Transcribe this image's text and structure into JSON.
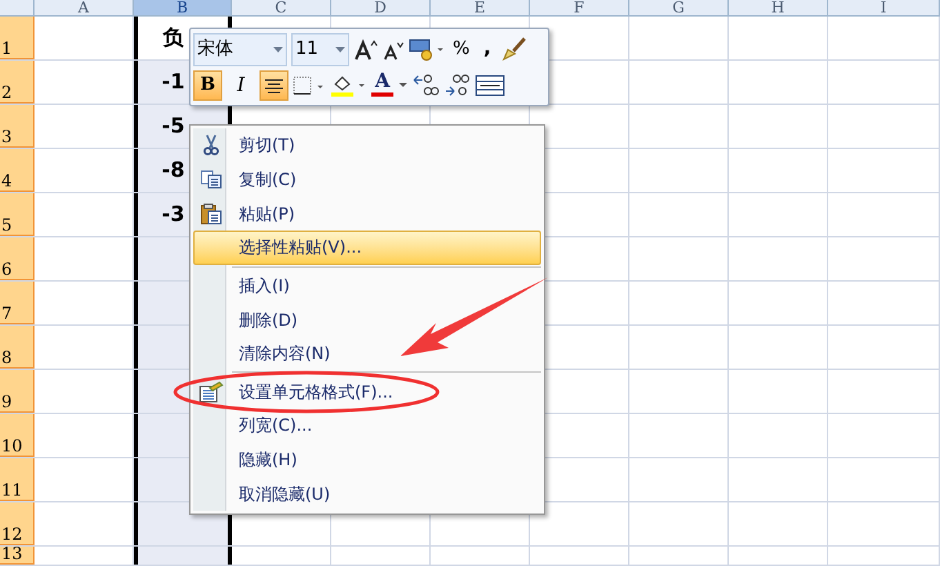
{
  "columns": [
    {
      "label": "A",
      "selected": false
    },
    {
      "label": "B",
      "selected": true
    },
    {
      "label": "C",
      "selected": false
    },
    {
      "label": "D",
      "selected": false
    },
    {
      "label": "E",
      "selected": false
    },
    {
      "label": "F",
      "selected": false
    },
    {
      "label": "G",
      "selected": false
    },
    {
      "label": "H",
      "selected": false
    },
    {
      "label": "I",
      "selected": false
    }
  ],
  "rows": [
    {
      "number": "1",
      "cell_b": "负",
      "selected": true
    },
    {
      "number": "2",
      "cell_b": "-1",
      "selected": true
    },
    {
      "number": "3",
      "cell_b": "-5",
      "selected": true
    },
    {
      "number": "4",
      "cell_b": "-8",
      "selected": true
    },
    {
      "number": "5",
      "cell_b": "-3",
      "selected": true
    },
    {
      "number": "6",
      "selected": true
    },
    {
      "number": "7",
      "selected": true
    },
    {
      "number": "8",
      "selected": true
    },
    {
      "number": "9",
      "selected": true
    },
    {
      "number": "10",
      "selected": true
    },
    {
      "number": "11",
      "selected": true
    },
    {
      "number": "12",
      "selected": true
    },
    {
      "number": "13",
      "selected": true
    }
  ],
  "toolbar": {
    "font": "宋体",
    "size": "11",
    "percent": "%",
    "comma": ",",
    "bold": {
      "label": "B",
      "selected": true
    },
    "italic": {
      "label": "I",
      "selected": false
    },
    "center": {
      "selected": true
    },
    "font_color_label": "A"
  },
  "menu": [
    {
      "kind": "item",
      "label": "剪切(T)",
      "highlighted": false
    },
    {
      "kind": "item",
      "label": "复制(C)",
      "highlighted": false
    },
    {
      "kind": "item",
      "label": "粘贴(P)",
      "highlighted": false
    },
    {
      "kind": "item",
      "label": "选择性粘贴(V)...",
      "highlighted": true
    },
    {
      "kind": "separator"
    },
    {
      "kind": "item",
      "label": "插入(I)",
      "highlighted": false
    },
    {
      "kind": "item",
      "label": "删除(D)",
      "highlighted": false
    },
    {
      "kind": "item",
      "label": "清除内容(N)",
      "highlighted": false
    },
    {
      "kind": "separator"
    },
    {
      "kind": "item",
      "label": "设置单元格格式(F)...",
      "highlighted": false
    },
    {
      "kind": "item",
      "label": "列宽(C)...",
      "highlighted": false
    },
    {
      "kind": "item",
      "label": "隐藏(H)",
      "highlighted": false
    },
    {
      "kind": "item",
      "label": "取消隐藏(U)",
      "highlighted": false
    }
  ]
}
